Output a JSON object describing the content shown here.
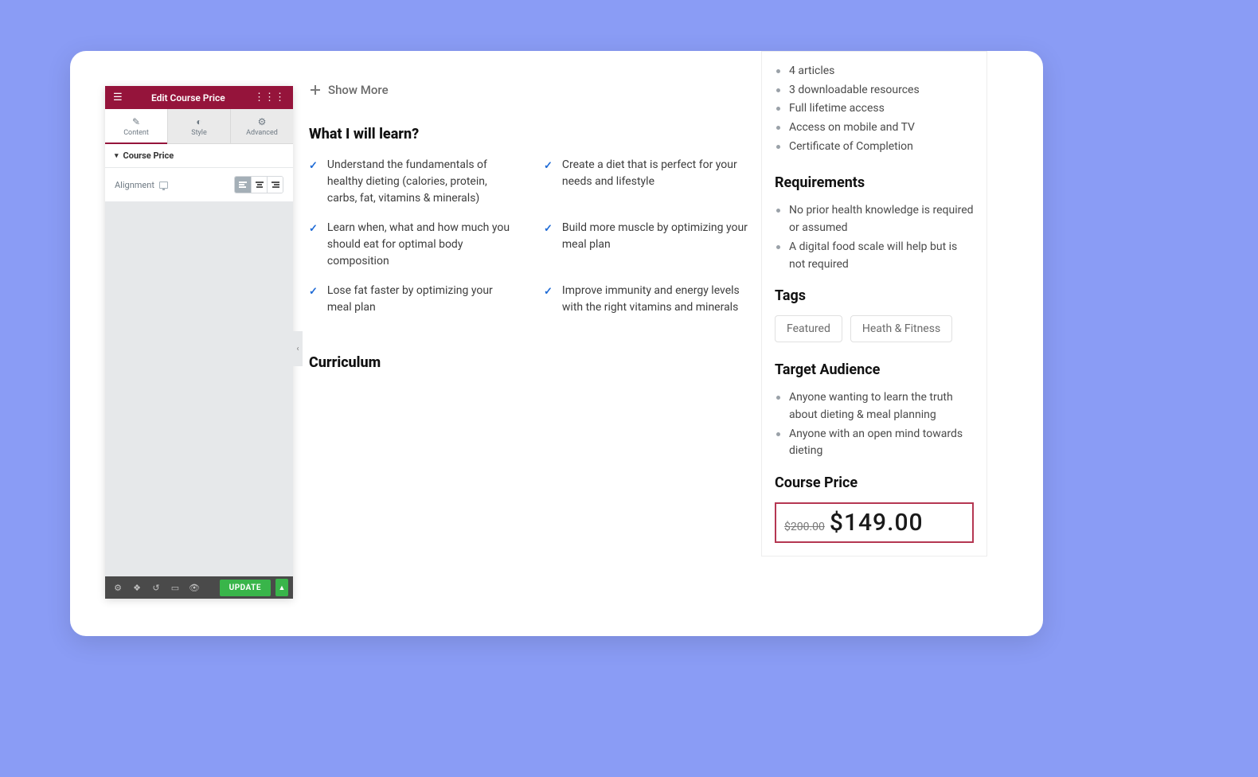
{
  "editor": {
    "title": "Edit Course Price",
    "tabs": {
      "content": "Content",
      "style": "Style",
      "advanced": "Advanced"
    },
    "section_label": "Course Price",
    "alignment_label": "Alignment",
    "update_label": "UPDATE"
  },
  "main": {
    "show_more": "Show More",
    "learn_heading": "What I will learn?",
    "learn_items": [
      "Understand the fundamentals of healthy dieting (calories, protein, carbs, fat, vitamins & minerals)",
      "Create a diet that is perfect for your needs and lifestyle",
      "Learn when, what and how much you should eat for optimal body composition",
      "Build more muscle by optimizing your meal plan",
      "Lose fat faster by optimizing your meal plan",
      "Improve immunity and energy levels with the right vitamins and minerals"
    ],
    "curriculum_heading": "Curriculum"
  },
  "sidebar": {
    "features": [
      "4 articles",
      "3 downloadable resources",
      "Full lifetime access",
      "Access on mobile and TV",
      "Certificate of Completion"
    ],
    "requirements_heading": "Requirements",
    "requirements": [
      "No prior health knowledge is required or assumed",
      "A digital food scale will help but is not required"
    ],
    "tags_heading": "Tags",
    "tags": [
      "Featured",
      "Heath & Fitness"
    ],
    "audience_heading": "Target Audience",
    "audience": [
      "Anyone wanting to learn the truth about dieting & meal planning",
      "Anyone with an open mind towards dieting"
    ],
    "price_heading": "Course Price",
    "price_old": "$200.00",
    "price_new": "$149.00"
  }
}
